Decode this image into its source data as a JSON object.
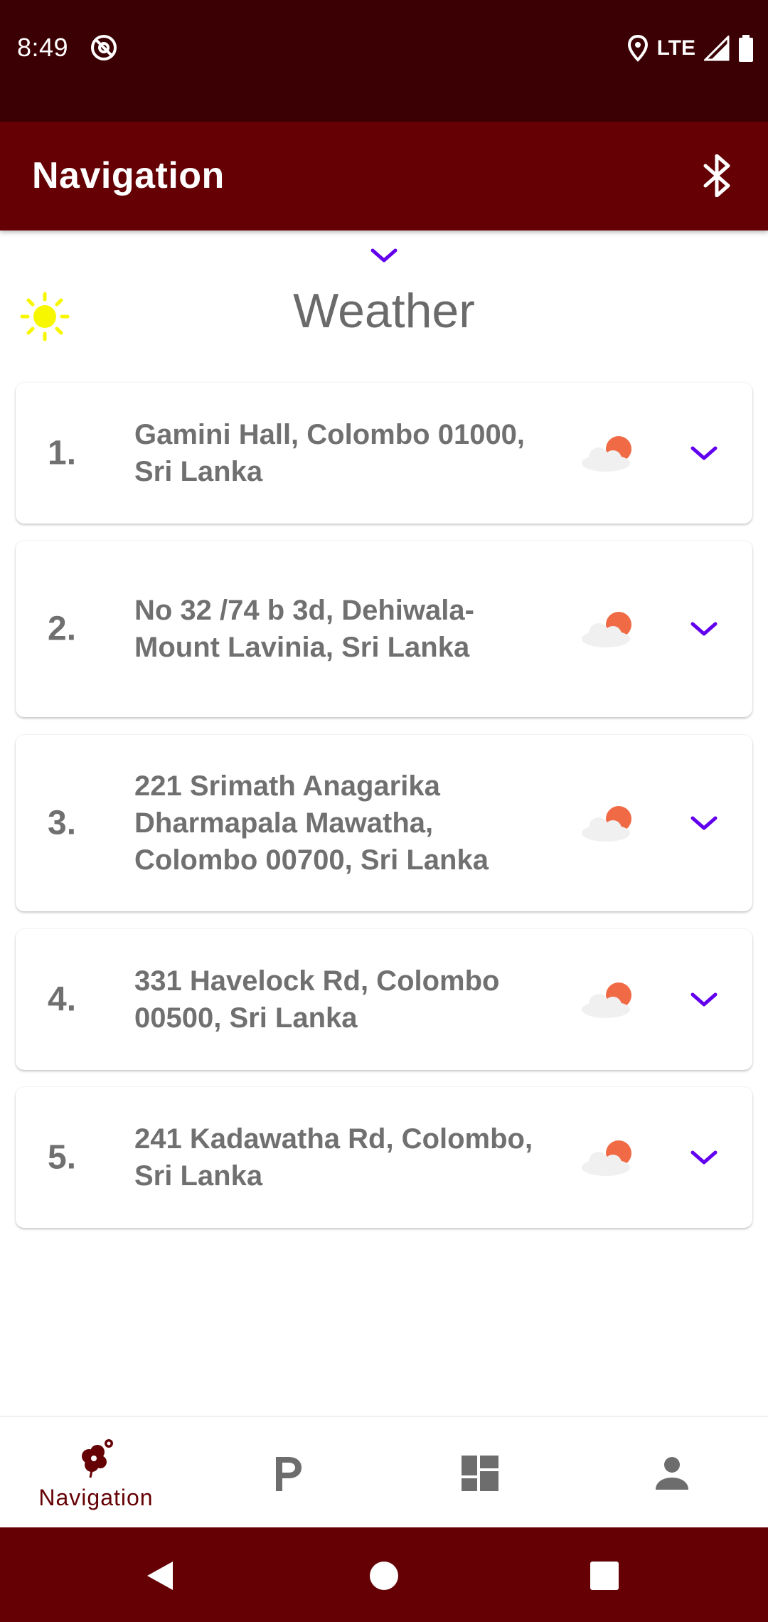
{
  "status_bar": {
    "time": "8:49",
    "network": "LTE"
  },
  "app_bar": {
    "title": "Navigation",
    "bluetooth_icon": "bluetooth-icon"
  },
  "weather": {
    "heading": "Weather",
    "sun_icon": "sun-icon",
    "sun_color": "#f7f700"
  },
  "locations": [
    {
      "number": "1.",
      "address": "Gamini Hall, Colombo 01000, Sri Lanka",
      "weather_icon": "partly-cloudy-icon"
    },
    {
      "number": "2.",
      "address": "No 32 /74 b 3d, Dehiwala-Mount Lavinia, Sri Lanka",
      "weather_icon": "partly-cloudy-icon"
    },
    {
      "number": "3.",
      "address": "221 Srimath Anagarika Dharmapala Mawatha, Colombo 00700, Sri Lanka",
      "weather_icon": "partly-cloudy-icon"
    },
    {
      "number": "4.",
      "address": "331 Havelock Rd, Colombo 00500, Sri Lanka",
      "weather_icon": "partly-cloudy-icon"
    },
    {
      "number": "5.",
      "address": "241 Kadawatha Rd, Colombo, Sri Lanka",
      "weather_icon": "partly-cloudy-icon"
    }
  ],
  "bottom_nav": {
    "items": [
      {
        "label": "Navigation",
        "icon": "navigation-flower-icon",
        "active": true
      },
      {
        "label": "",
        "icon": "parking-icon",
        "active": false
      },
      {
        "label": "",
        "icon": "dashboard-icon",
        "active": false
      },
      {
        "label": "",
        "icon": "person-icon",
        "active": false
      }
    ]
  },
  "colors": {
    "status_bar": "#3b0003",
    "primary": "#650004",
    "accent": "#6200ee",
    "text_gray": "#707070"
  }
}
